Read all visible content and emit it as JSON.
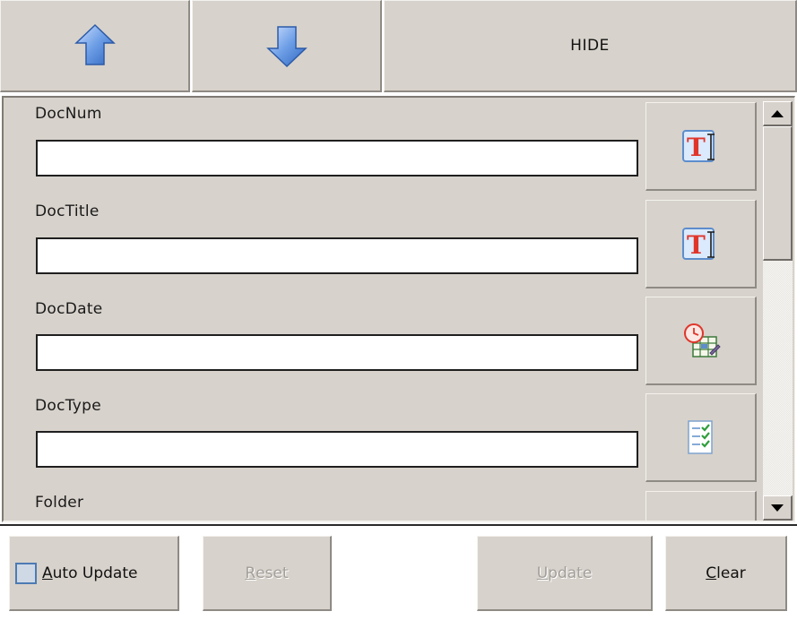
{
  "toolbar": {
    "move_up_icon": "arrow-up-icon",
    "move_down_icon": "arrow-down-icon",
    "hide_label": "HIDE"
  },
  "fields": [
    {
      "label": "DocNum",
      "value": "",
      "action_icon": "text-entry-icon"
    },
    {
      "label": "DocTitle",
      "value": "",
      "action_icon": "text-entry-icon"
    },
    {
      "label": "DocDate",
      "value": "",
      "action_icon": "date-picker-icon"
    },
    {
      "label": "DocType",
      "value": "",
      "action_icon": "checklist-icon"
    },
    {
      "label": "Folder",
      "value": "",
      "action_icon": "list-icon"
    }
  ],
  "bottom": {
    "auto_update": {
      "mnemonic": "A",
      "rest": "uto Update",
      "checked": false
    },
    "reset": {
      "mnemonic": "R",
      "rest": "eset",
      "enabled": false
    },
    "update": {
      "mnemonic": "U",
      "rest": "pdate",
      "enabled": false
    },
    "clear": {
      "mnemonic": "C",
      "rest": "lear",
      "enabled": true
    }
  },
  "colors": {
    "face": "#d7d2cb",
    "arrow_blue": "#5e8fd8",
    "icon_red": "#e0352b"
  }
}
